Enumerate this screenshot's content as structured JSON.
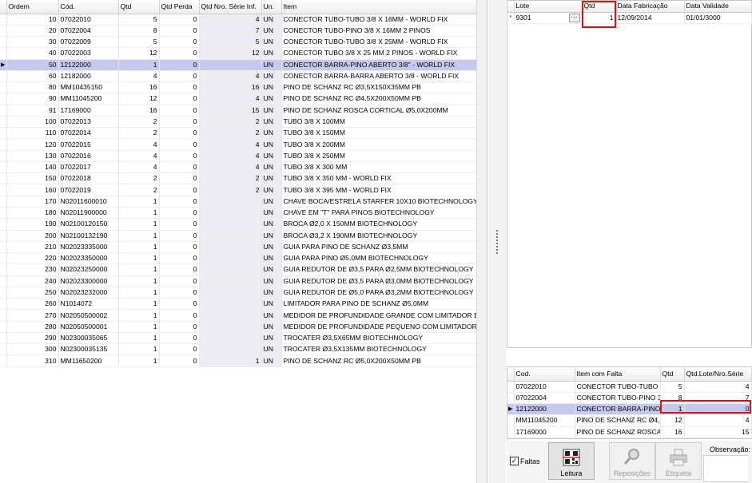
{
  "main_grid": {
    "columns": [
      "Ordem",
      "Cód.",
      "Qtd",
      "Qtd Perda",
      "Qtd Nro. Série Inf.",
      "Un.",
      "Item"
    ],
    "selected_index": 4,
    "rows": [
      {
        "ordem": "10",
        "cod": "07022010",
        "qtd": "5",
        "perda": "0",
        "serie": "4",
        "un": "UN",
        "item": "CONECTOR TUBO-TUBO 3/8 X 16MM - WORLD FIX"
      },
      {
        "ordem": "20",
        "cod": "07022004",
        "qtd": "8",
        "perda": "0",
        "serie": "7",
        "un": "UN",
        "item": "CONECTOR TUBO-PINO 3/8 X 16MM 2 PINOS"
      },
      {
        "ordem": "30",
        "cod": "07022009",
        "qtd": "5",
        "perda": "0",
        "serie": "5",
        "un": "UN",
        "item": "CONECTOR TUBO-TUBO 3/8 X 25MM - WORLD FIX"
      },
      {
        "ordem": "40",
        "cod": "07022003",
        "qtd": "12",
        "perda": "0",
        "serie": "12",
        "un": "UN",
        "item": "CONECTOR TUBO 3/8  X 25 MM 2 PINOS - WORLD FIX"
      },
      {
        "ordem": "50",
        "cod": "12122000",
        "qtd": "1",
        "perda": "0",
        "serie": "",
        "un": "UN",
        "item": "CONECTOR BARRA-PINO ABERTO 3/8\"  -  WORLD FIX"
      },
      {
        "ordem": "60",
        "cod": "12182000",
        "qtd": "4",
        "perda": "0",
        "serie": "4",
        "un": "UN",
        "item": "CONECTOR BARRA-BARRA ABERTO 3/8  - WORLD FIX"
      },
      {
        "ordem": "80",
        "cod": "MM10435150",
        "qtd": "16",
        "perda": "0",
        "serie": "16",
        "un": "UN",
        "item": "PINO DE SCHANZ RC Ø3,5X150X35MM PB"
      },
      {
        "ordem": "90",
        "cod": "MM11045200",
        "qtd": "12",
        "perda": "0",
        "serie": "4",
        "un": "UN",
        "item": "PINO DE SCHANZ RC Ø4,5X200X50MM PB"
      },
      {
        "ordem": "91",
        "cod": "17169000",
        "qtd": "16",
        "perda": "0",
        "serie": "15",
        "un": "UN",
        "item": "PINO DE SCHANZ ROSCA CORTICAL Ø5,0X200MM"
      },
      {
        "ordem": "100",
        "cod": "07022013",
        "qtd": "2",
        "perda": "0",
        "serie": "2",
        "un": "UN",
        "item": "TUBO 3/8 X 100MM"
      },
      {
        "ordem": "110",
        "cod": "07022014",
        "qtd": "2",
        "perda": "0",
        "serie": "2",
        "un": "UN",
        "item": "TUBO 3/8 X 150MM"
      },
      {
        "ordem": "120",
        "cod": "07022015",
        "qtd": "4",
        "perda": "0",
        "serie": "4",
        "un": "UN",
        "item": "TUBO 3/8 X 200MM"
      },
      {
        "ordem": "130",
        "cod": "07022016",
        "qtd": "4",
        "perda": "0",
        "serie": "4",
        "un": "UN",
        "item": "TUBO 3/8 X 250MM"
      },
      {
        "ordem": "140",
        "cod": "07022017",
        "qtd": "4",
        "perda": "0",
        "serie": "4",
        "un": "UN",
        "item": "TUBO 3/8 X 300 MM"
      },
      {
        "ordem": "150",
        "cod": "07022018",
        "qtd": "2",
        "perda": "0",
        "serie": "2",
        "un": "UN",
        "item": "TUBO 3/8 X 350 MM - WORLD FIX"
      },
      {
        "ordem": "160",
        "cod": "07022019",
        "qtd": "2",
        "perda": "0",
        "serie": "2",
        "un": "UN",
        "item": "TUBO 3/8 X 395 MM - WORLD FIX"
      },
      {
        "ordem": "170",
        "cod": "N02011600010",
        "qtd": "1",
        "perda": "0",
        "serie": "",
        "un": "UN",
        "item": "CHAVE BOCA/ESTRELA STARFER 10X10 BIOTECHNOLOGY"
      },
      {
        "ordem": "180",
        "cod": "N02011900000",
        "qtd": "1",
        "perda": "0",
        "serie": "",
        "un": "UN",
        "item": "CHAVE EM \"T\" PARA PINOS BIOTECHNOLOGY"
      },
      {
        "ordem": "190",
        "cod": "N02100120150",
        "qtd": "1",
        "perda": "0",
        "serie": "",
        "un": "UN",
        "item": "BROCA Ø2,0 X 150MM BIOTECHNOLOGY"
      },
      {
        "ordem": "200",
        "cod": "N02100132190",
        "qtd": "1",
        "perda": "0",
        "serie": "",
        "un": "UN",
        "item": "BROCA Ø3,2 X 190MM BIOTECHNOLOGY"
      },
      {
        "ordem": "210",
        "cod": "N02023335000",
        "qtd": "1",
        "perda": "0",
        "serie": "",
        "un": "UN",
        "item": "GUIA PARA PINO DE SCHANZ  Ø3,5MM"
      },
      {
        "ordem": "220",
        "cod": "N02023350000",
        "qtd": "1",
        "perda": "0",
        "serie": "",
        "un": "UN",
        "item": "GUIA PARA PINO Ø5,0MM BIOTECHNOLOGY"
      },
      {
        "ordem": "230",
        "cod": "N02023250000",
        "qtd": "1",
        "perda": "0",
        "serie": "",
        "un": "UN",
        "item": "GUIA REDUTOR DE Ø3,5 PARA Ø2,5MM BIOTECHNOLOGY"
      },
      {
        "ordem": "240",
        "cod": "N02023300000",
        "qtd": "1",
        "perda": "0",
        "serie": "",
        "un": "UN",
        "item": "GUIA REDUTOR DE Ø3,5 PARA Ø3,0MM BIOTECHNOLOGY"
      },
      {
        "ordem": "250",
        "cod": "N02023232000",
        "qtd": "1",
        "perda": "0",
        "serie": "",
        "un": "UN",
        "item": "GUIA REDUTOR DE Ø5,0 PARA Ø3,2MM BIOTECHNOLOGY"
      },
      {
        "ordem": "260",
        "cod": "N1014072",
        "qtd": "1",
        "perda": "0",
        "serie": "",
        "un": "UN",
        "item": "LIMITADOR PARA PINO DE SCHANZ Ø5,0MM"
      },
      {
        "ordem": "270",
        "cod": "N02050500002",
        "qtd": "1",
        "perda": "0",
        "serie": "",
        "un": "UN",
        "item": "MEDIDOR DE PROFUNDIDADE GRANDE COM LIMITADOR BIOTI"
      },
      {
        "ordem": "280",
        "cod": "N02050500001",
        "qtd": "1",
        "perda": "0",
        "serie": "",
        "un": "UN",
        "item": "MEDIDOR DE PROFUNDIDADE PEQUENO COM LIMITADOR BIOTI"
      },
      {
        "ordem": "290",
        "cod": "N02300035065",
        "qtd": "1",
        "perda": "0",
        "serie": "",
        "un": "UN",
        "item": "TROCATER Ø3,5X65MM BIOTECHNOLOGY"
      },
      {
        "ordem": "300",
        "cod": "N02300035135",
        "qtd": "1",
        "perda": "0",
        "serie": "",
        "un": "UN",
        "item": "TROCATER Ø3,5X135MM BIOTECHNOLOGY"
      },
      {
        "ordem": "310",
        "cod": "MM11650200",
        "qtd": "1",
        "perda": "0",
        "serie": "1",
        "un": "UN",
        "item": "PINO DE SCHANZ RC Ø5,0X200X50MM PB"
      }
    ]
  },
  "lote_grid": {
    "columns": [
      "Lote",
      "Qtd",
      "Data Fabricação",
      "Data Validade"
    ],
    "new_row_marker": "*",
    "ellipsis": "···",
    "rows": [
      {
        "lote": "9301",
        "qtd": "1",
        "fabricacao": "12/09/2014",
        "validade": "01/01/3000"
      }
    ]
  },
  "falta_grid": {
    "columns": [
      "Cod.",
      "Item com Falta",
      "Qtd",
      "Qtd.Lote/Nro.Série"
    ],
    "selected_index": 2,
    "rows": [
      {
        "cod": "07022010",
        "item": "CONECTOR TUBO-TUBO 3/8",
        "qtd": "5",
        "lote": "4"
      },
      {
        "cod": "07022004",
        "item": "CONECTOR TUBO-PINO 3/8",
        "qtd": "8",
        "lote": "7"
      },
      {
        "cod": "12122000",
        "item": "CONECTOR BARRA-PINO A",
        "qtd": "1",
        "lote": "0"
      },
      {
        "cod": "MM11045200",
        "item": "PINO DE SCHANZ RC Ø4,5X",
        "qtd": "12",
        "lote": "4"
      },
      {
        "cod": "17169000",
        "item": "PINO DE SCHANZ ROSCA C",
        "qtd": "16",
        "lote": "15"
      }
    ]
  },
  "bottom": {
    "faltas_label": "Faltas",
    "faltas_checked": true,
    "leitura_label": "Leitura",
    "reposicoes_label": "Reposições",
    "etiqueta_label": "Etiqueta",
    "observacao_label": "Observação:"
  },
  "colors": {
    "selection": "#c5c9ee",
    "highlight": "#e01010"
  }
}
